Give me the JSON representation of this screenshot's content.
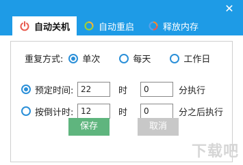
{
  "window": {
    "close_glyph": "✕"
  },
  "tabs": [
    {
      "label": "自动关机",
      "icon": "power-icon",
      "color": "#e85a4f",
      "active": true
    },
    {
      "label": "自动重启",
      "icon": "restart-icon",
      "color": "#f0b23a",
      "active": false
    },
    {
      "label": "释放内存",
      "icon": "memory-release-icon",
      "color": "#f28a2e",
      "active": false
    }
  ],
  "repeat": {
    "label": "重复方式:",
    "options": [
      {
        "label": "单次",
        "checked": true
      },
      {
        "label": "每天",
        "checked": false
      },
      {
        "label": "工作日",
        "checked": false
      }
    ]
  },
  "scheduled": {
    "label": "预定时间:",
    "checked": true,
    "hour_value": "22",
    "hour_unit": "时",
    "minute_value": "0",
    "minute_unit": "分执行"
  },
  "countdown": {
    "label": "按倒计时:",
    "checked": false,
    "hour_value": "12",
    "hour_unit": "时",
    "minute_value": "0",
    "minute_unit": "分之后执行"
  },
  "buttons": {
    "save": "保存",
    "cancel": "取消"
  },
  "watermark": "下载吧",
  "colors": {
    "accent": "#1e9be6",
    "save": "#5fb57e",
    "radio": "#2a8fd8"
  }
}
